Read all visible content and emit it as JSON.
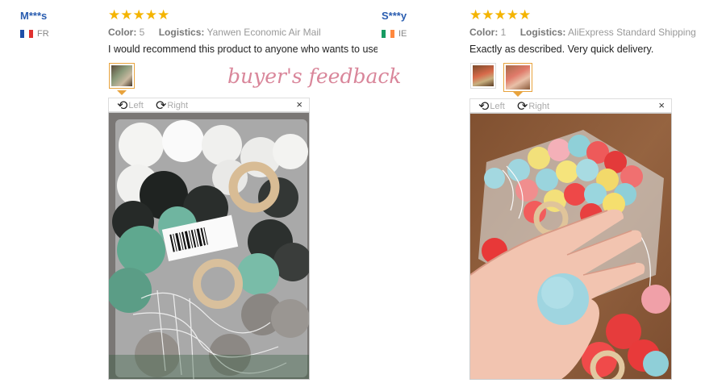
{
  "reviews": [
    {
      "user": "M***s",
      "country": "FR",
      "stars": "★★★★★",
      "color_label": "Color:",
      "color_value": "5",
      "logistics_label": "Logistics:",
      "logistics_value": "Yanwen Economic Air Mail",
      "text": "I would recommend this product to anyone who wants to use it",
      "rotate_left": "Left",
      "rotate_right": "Right",
      "close": "×"
    },
    {
      "user": "S***y",
      "country": "IE",
      "stars": "★★★★★",
      "color_label": "Color:",
      "color_value": "1",
      "logistics_label": "Logistics:",
      "logistics_value": "AliExpress Standard Shipping",
      "text": "Exactly as described. Very quick delivery.",
      "rotate_left": "Left",
      "rotate_right": "Right",
      "close": "×"
    }
  ],
  "watermark": "buyer's feedback",
  "colors": {
    "star": "#f4b400",
    "username": "#2a5db0",
    "thumb_border": "#e8a33d",
    "watermark": "#d9869a"
  },
  "icons": {
    "rotate_left": "rotate-left-icon",
    "rotate_right": "rotate-right-icon",
    "close": "close-icon"
  }
}
